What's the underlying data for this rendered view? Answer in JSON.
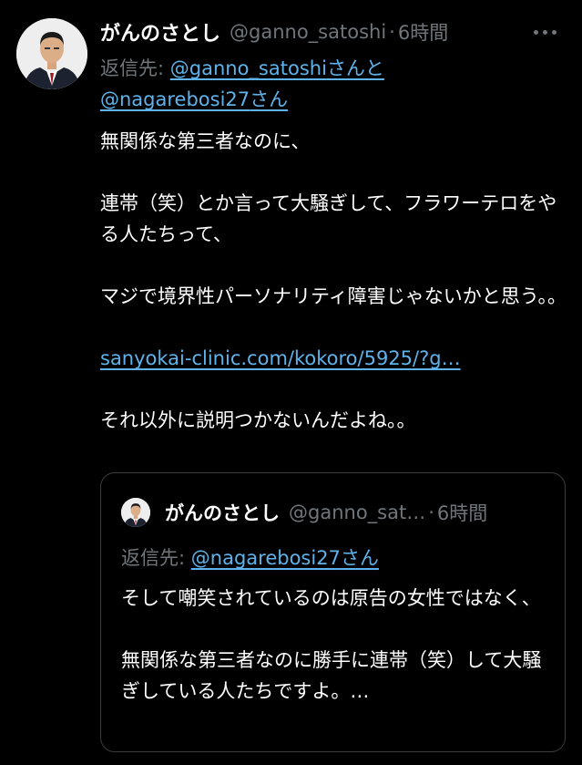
{
  "tweet": {
    "author_name": "がんのさとし",
    "author_handle": "@ganno_satoshi",
    "time_separator": "·",
    "time": "6時間",
    "more_icon": "more-horizontal-icon",
    "reply_prefix": "返信先: ",
    "reply_handle_1": "@ganno_satoshi",
    "reply_join": "さんと",
    "reply_handle_2": "@nagarebosi27",
    "reply_suffix": "さん",
    "lines": [
      "無関係な第三者なのに、",
      "連帯（笑）とか言って大騒ぎして、フラワーテロをやる人たちって、",
      "マジで境界性パーソナリティ障害じゃないかと思う。。",
      "sanyokai-clinic.com/kokoro/5925/?g…",
      "それ以外に説明つかないんだよね。。"
    ]
  },
  "quote": {
    "author_name": "がんのさとし",
    "author_handle": "@ganno_sat…",
    "time_separator": "·",
    "time": "6時間",
    "reply_prefix": "返信先: ",
    "reply_handle": "@nagarebosi27",
    "reply_suffix": "さん",
    "lines": [
      "そして嘲笑されているのは原告の女性ではなく、",
      "無関係な第三者なのに勝手に連帯（笑）して大騒ぎしている人たちですよ。…"
    ]
  },
  "colors": {
    "background": "#000000",
    "text": "#ffffff",
    "muted": "#71767b",
    "link": "#5fb3ea",
    "border": "#3a3d40"
  }
}
